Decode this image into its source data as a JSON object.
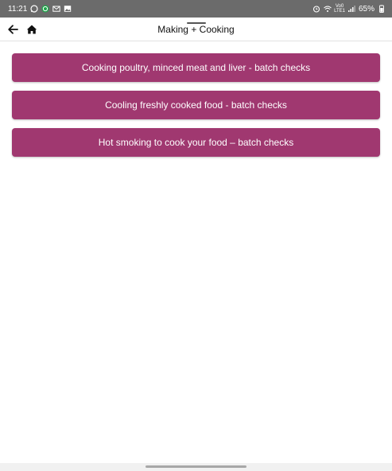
{
  "status_bar": {
    "time": "11:21",
    "battery": "65%",
    "network_top": "Vo0",
    "network_bottom": "LTE1",
    "left_icons": [
      "whatsapp-icon",
      "alarm-clock-icon",
      "gmail-icon",
      "gallery-icon"
    ],
    "right_icons": [
      "alarm-icon",
      "wifi-icon",
      "signal-icon",
      "battery-icon"
    ]
  },
  "header": {
    "title": "Making + Cooking",
    "back_icon": "arrow-left-icon",
    "home_icon": "home-icon"
  },
  "menu": {
    "items": [
      {
        "label": "Cooking poultry, minced meat and liver - batch checks"
      },
      {
        "label": "Cooling freshly cooked food - batch checks"
      },
      {
        "label": "Hot smoking to cook your food – batch checks"
      }
    ]
  },
  "colors": {
    "accent": "#a03870",
    "status_bar": "#6b6b6b"
  }
}
